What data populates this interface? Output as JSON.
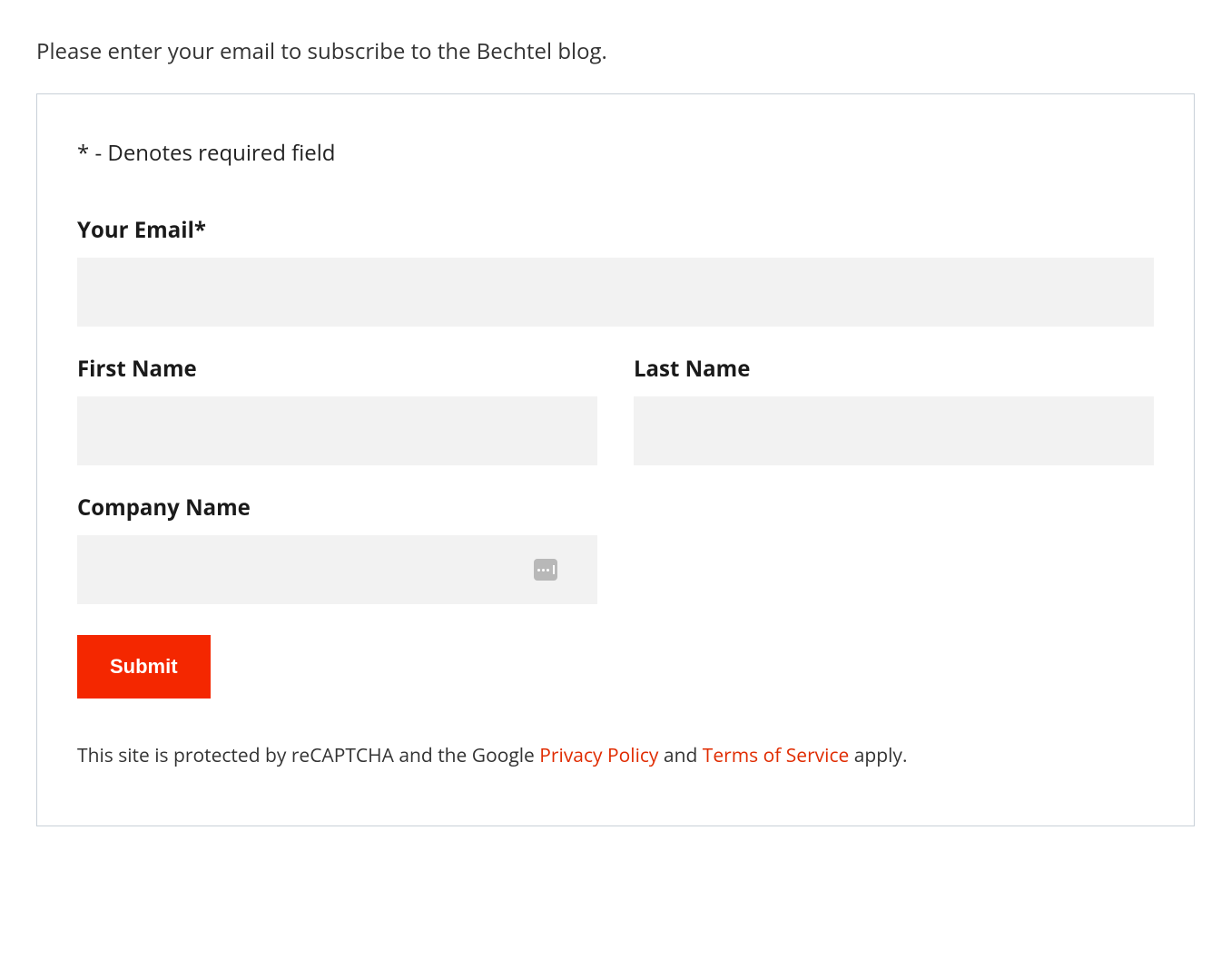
{
  "intro_text": "Please enter your email to subscribe to the Bechtel blog.",
  "required_note": "* - Denotes required field",
  "fields": {
    "email": {
      "label": "Your Email*",
      "value": ""
    },
    "first_name": {
      "label": "First Name",
      "value": ""
    },
    "last_name": {
      "label": "Last Name",
      "value": ""
    },
    "company": {
      "label": "Company Name",
      "value": ""
    }
  },
  "submit_label": "Submit",
  "recaptcha": {
    "prefix": "This site is protected by reCAPTCHA and the Google ",
    "privacy_link": "Privacy Policy",
    "mid": " and ",
    "terms_link": "Terms of Service",
    "suffix": " apply."
  },
  "colors": {
    "accent": "#f42700",
    "input_bg": "#f2f2f2",
    "border": "#c8d0d8"
  }
}
